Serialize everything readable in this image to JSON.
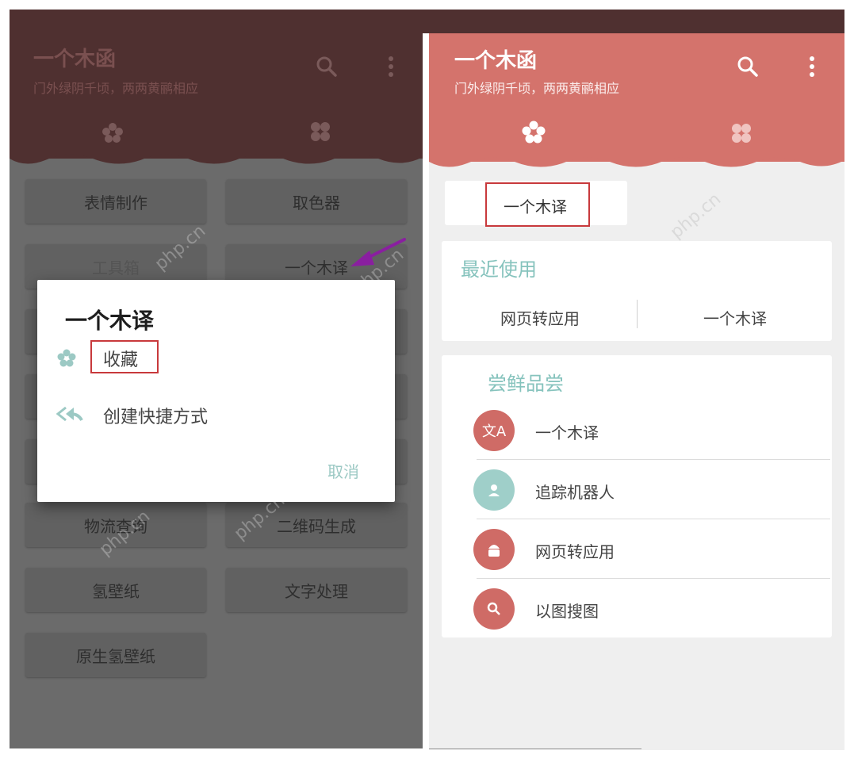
{
  "left": {
    "app_title": "一个木函",
    "app_subtitle": "门外绿阴千顷，两两黄鹂相应",
    "tools": [
      "表情制作",
      "取色器",
      "工具箱",
      "一个木译",
      "物流查询",
      "二维码生成",
      "氢壁纸",
      "文字处理",
      "原生氢壁纸"
    ],
    "dialog": {
      "title": "一个木译",
      "items": [
        "收藏",
        "创建快捷方式"
      ],
      "cancel": "取消"
    }
  },
  "right": {
    "app_title": "一个木函",
    "app_subtitle": "门外绿阴千顷，两两黄鹂相应",
    "favorite_tool": "一个木译",
    "recent": {
      "title": "最近使用",
      "items": [
        "网页转应用",
        "一个木译"
      ]
    },
    "trial": {
      "title": "尝鲜品尝",
      "items": [
        {
          "label": "一个木译",
          "icon": "translate-icon",
          "color": "#cf6b66"
        },
        {
          "label": "追踪机器人",
          "icon": "person-icon",
          "color": "#9fcfc9"
        },
        {
          "label": "网页转应用",
          "icon": "android-icon",
          "color": "#cf6b66"
        },
        {
          "label": "以图搜图",
          "icon": "search-icon",
          "color": "#cf6b66"
        }
      ]
    }
  },
  "watermark": "php.cn",
  "colors": {
    "left_header": "#4f3030",
    "right_header": "#d4736c",
    "accent_teal": "#86c3bd",
    "highlight_red": "#c8393c",
    "arrow_purple": "#8a1fa0"
  }
}
